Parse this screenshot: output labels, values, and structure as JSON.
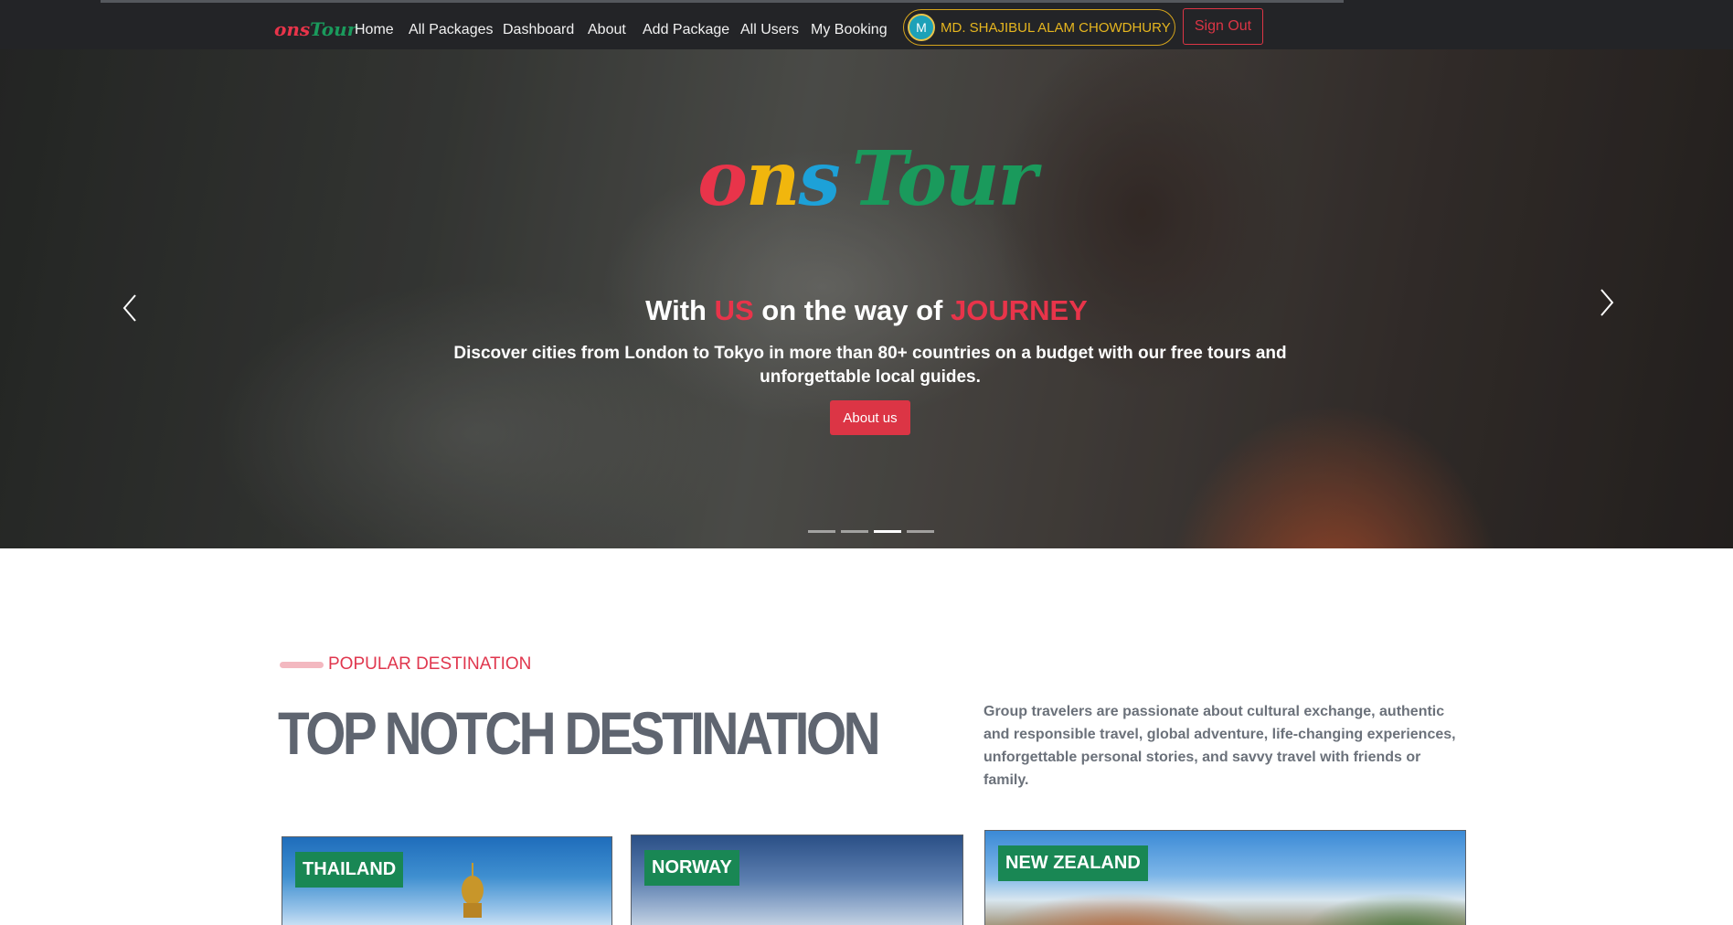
{
  "colors": {
    "nav_bg": "#232427",
    "accent_red": "#dc3545",
    "accent_gold": "#e6b61f",
    "badge_green": "#198754",
    "logo_letters": [
      "#e8344a",
      "#f1b60d",
      "#1da1d8",
      "#1a9a5c"
    ]
  },
  "nav": {
    "brand_ons": "ons",
    "brand_tour": "Tour",
    "links": [
      "Home",
      "All Packages",
      "Dashboard",
      "About",
      "Add Package",
      "All Users",
      "My Booking"
    ],
    "user_initial": "M",
    "user_name": "MD. SHAJIBUL ALAM CHOWDHURY",
    "signout": "Sign Out"
  },
  "hero": {
    "logo_ons": [
      "o",
      "n",
      "s"
    ],
    "logo_tour": "Tour",
    "title_parts": [
      "With ",
      "US",
      " on the way of ",
      "JOURNEY"
    ],
    "description": "Discover cities from London to Tokyo in more than 80+ countries on a budget with our free tours and unforgettable local guides.",
    "button": "About us",
    "prev_icon": "chevron-left-icon",
    "next_icon": "chevron-right-icon",
    "slide_count": 4,
    "active_slide": 3
  },
  "section": {
    "label": "POPULAR DESTINATION",
    "title": "TOP NOTCH DESTINATION",
    "description": "Group travelers are passionate about cultural exchange, authentic and responsible travel, global adventure, life-changing experiences, unforgettable personal stories, and savvy travel with friends or family."
  },
  "cards": [
    {
      "name": "THAILAND"
    },
    {
      "name": "NORWAY"
    },
    {
      "name": "NEW ZEALAND"
    }
  ]
}
